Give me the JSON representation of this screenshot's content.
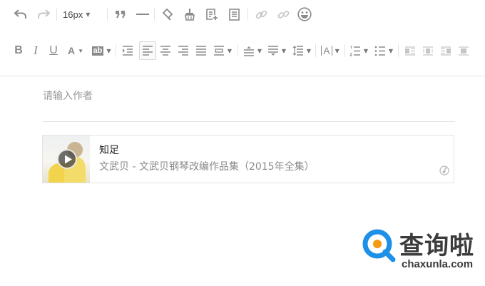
{
  "toolbar": {
    "font_size": "16px",
    "icons": {
      "undo": "undo-icon",
      "redo": "redo-icon",
      "quote": "quote-icon",
      "hr": "horizontal-rule-icon",
      "format_painter": "format-painter-icon",
      "clear_format": "clear-format-icon",
      "template": "insert-template-icon",
      "preview": "preview-icon",
      "link": "link-icon",
      "unlink": "unlink-icon",
      "emoji": "emoji-icon",
      "bold": "bold-icon",
      "italic": "italic-icon",
      "underline": "underline-icon",
      "font_color": "font-color-icon",
      "bg_color": "background-color-icon",
      "indent": "indent-icon",
      "align_left": "align-left-icon",
      "align_center": "align-center-icon",
      "align_right": "align-right-icon",
      "justify": "justify-icon",
      "paragraph_spacing": "paragraph-spacing-icon",
      "spacing_before": "spacing-before-icon",
      "spacing_after": "spacing-after-icon",
      "line_height": "line-height-icon",
      "letter_spacing": "letter-spacing-icon",
      "ordered_list": "ordered-list-icon",
      "unordered_list": "unordered-list-icon",
      "float_left": "float-left-icon",
      "float_center": "float-center-icon",
      "float_right": "float-right-icon",
      "float_none": "float-none-icon"
    },
    "bold_letter": "B",
    "italic_letter": "I",
    "underline_letter": "U",
    "font_color_letter": "A",
    "bg_color_letter": "ab",
    "letter_spacing_letter": "A"
  },
  "editor": {
    "author_placeholder": "请输入作者"
  },
  "music_card": {
    "title": "知足",
    "subtitle": "文武贝 - 文武贝钢琴改编作品集（2015年全集）",
    "play_icon": "play-icon",
    "badge_icon": "music-note-icon"
  },
  "watermark": {
    "brand": "查询啦",
    "domain": "chaxunla.com",
    "colors": {
      "ring": "#1e90e8",
      "dot": "#f39c12"
    }
  }
}
